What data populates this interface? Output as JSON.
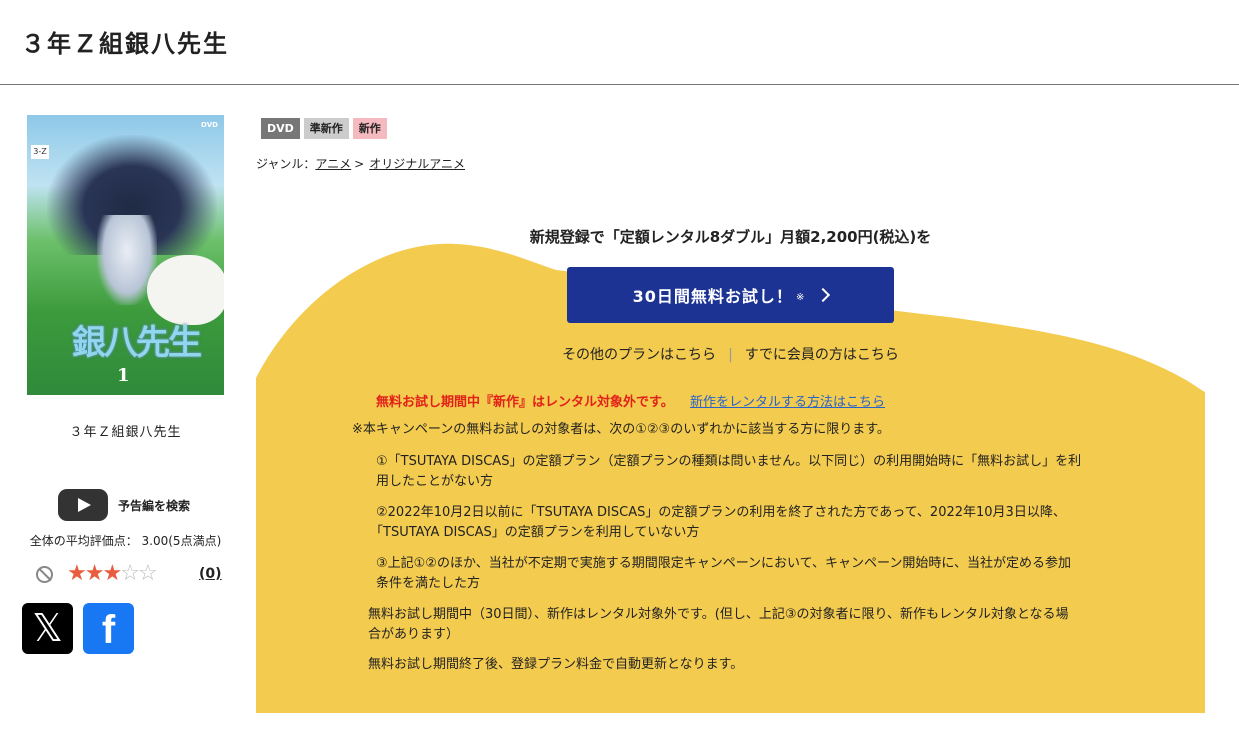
{
  "page": {
    "title": "３年Ｚ組銀八先生"
  },
  "cover": {
    "caption": "３年Ｚ組銀八先生",
    "logo_text": "銀八先生",
    "volume_number": "1",
    "tag": "3-Z",
    "format_mark": "DVD"
  },
  "sidebar": {
    "trailer_label": "予告編を検索",
    "avg_rating": "全体の平均評価点：  3.00(5点満点)",
    "stars": 3,
    "max_stars": 5,
    "review_count": "(0)",
    "x_icon": "x-logo-icon",
    "fb_icon": "facebook-icon"
  },
  "badges": [
    "DVD",
    "準新作",
    "新作"
  ],
  "genre": {
    "label": "ジャンル：",
    "primary": "アニメ",
    "separator": ">",
    "secondary": "オリジナルアニメ"
  },
  "promo": {
    "headline": "新規登録で「定額レンタル8ダブル」月額2,200円(税込)を",
    "cta_label": "30日間無料お試し！",
    "cta_note": "※",
    "other_plans": "その他のプランはこちら",
    "members": "すでに会員の方はこちら",
    "notice_red": "無料お試し期間中『新作』はレンタル対象外です。",
    "notice_link": "新作をレンタルする方法はこちら",
    "terms_intro": "※本キャンペーンの無料お試しの対象者は、次の①②③のいずれかに該当する方に限ります。",
    "condition_1_line1": "①「TSUTAYA DISCAS」の定額プラン（定額プランの種類は問いません。以下同じ）の利用開始時に「無料お試し」を利",
    "condition_1_line2": "用したことがない方",
    "condition_2_line1": "②2022年10月2日以前に「TSUTAYA DISCAS」の定額プランの利用を終了された方であって、2022年10月3日以降、",
    "condition_2_line2": "「TSUTAYA DISCAS」の定額プランを利用していない方",
    "condition_3_line1": "③上記①②のほか、当社が不定期で実施する期間限定キャンペーンにおいて、キャンペーン開始時に、当社が定める参加",
    "condition_3_line2": "条件を満たした方",
    "trial_note_line1": "無料お試し期間中（30日間）、新作はレンタル対象外です。(但し、上記③の対象者に限り、新作もレンタル対象となる場",
    "trial_note_line2": "合があります）",
    "renewal_note": "無料お試し期間終了後、登録プラン料金で自動更新となります。"
  },
  "colors": {
    "yellow_panel": "#f3cb4e",
    "cta_button": "#1d3393",
    "notice_red": "#e3211b",
    "link_blue": "#2a63c8",
    "star_on": "#e85d3f"
  }
}
